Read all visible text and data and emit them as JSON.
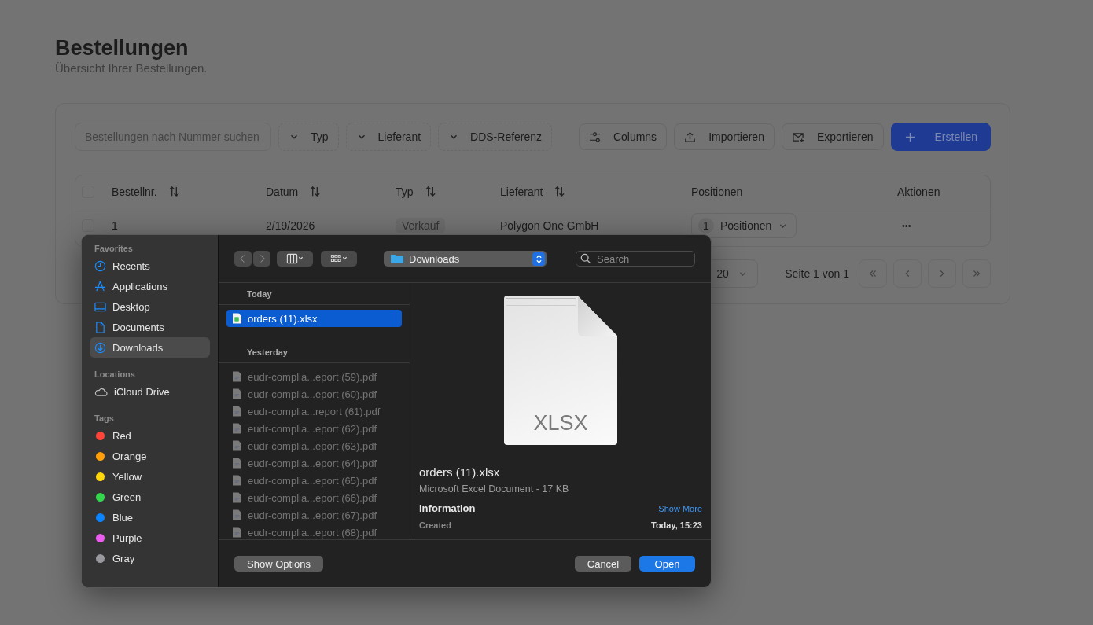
{
  "page": {
    "title": "Bestellungen",
    "subtitle": "Übersicht Ihrer Bestellungen."
  },
  "toolbar": {
    "search": {
      "placeholder": "Bestellungen nach Nummer suchen"
    },
    "filters": [
      {
        "label": "Typ"
      },
      {
        "label": "Lieferant"
      },
      {
        "label": "DDS-Referenz"
      }
    ],
    "buttons": [
      {
        "label": "Columns",
        "kind": "columns"
      },
      {
        "label": "Importieren",
        "kind": "import"
      },
      {
        "label": "Exportieren",
        "kind": "export"
      },
      {
        "label": "Erstellen",
        "kind": "create"
      }
    ]
  },
  "table": {
    "select_all": {
      "checked": false
    },
    "columns": [
      {
        "label": "Bestellnr.",
        "sortable": true
      },
      {
        "label": "Datum",
        "sortable": true
      },
      {
        "label": "Typ",
        "sortable": true
      },
      {
        "label": "Lieferant",
        "sortable": true
      },
      {
        "label": "Positionen",
        "sortable": false
      },
      {
        "label": "Aktionen",
        "sortable": false
      }
    ],
    "rows": [
      {
        "checked": false,
        "number": "1",
        "date": "2/19/2026",
        "type": "Verkauf",
        "supplier": "Polygon One GmbH",
        "positions_count": "1",
        "positions_label": "Positionen",
        "actions": "•••"
      }
    ]
  },
  "pagination": {
    "page_size": "20",
    "page_info": "Seite 1 von 1"
  },
  "dialog": {
    "location": "Downloads",
    "search": {
      "placeholder": "Search"
    },
    "sidebar": [
      {
        "heading": "Favorites",
        "items": [
          {
            "label": "Recents",
            "kind": "recents",
            "selected": false
          },
          {
            "label": "Applications",
            "kind": "applications",
            "selected": false
          },
          {
            "label": "Desktop",
            "kind": "desktop",
            "selected": false
          },
          {
            "label": "Documents",
            "kind": "documents",
            "selected": false
          },
          {
            "label": "Downloads",
            "kind": "downloads",
            "selected": true
          }
        ]
      },
      {
        "heading": "Locations",
        "items": [
          {
            "label": "iCloud Drive",
            "kind": "icloud",
            "selected": false
          }
        ]
      },
      {
        "heading": "Tags",
        "items": [
          {
            "label": "Red",
            "kind": "tag",
            "color": "#ff453a",
            "selected": false
          },
          {
            "label": "Orange",
            "kind": "tag",
            "color": "#ff9f0a",
            "selected": false
          },
          {
            "label": "Yellow",
            "kind": "tag",
            "color": "#ffd60a",
            "selected": false
          },
          {
            "label": "Green",
            "kind": "tag",
            "color": "#32d74b",
            "selected": false
          },
          {
            "label": "Blue",
            "kind": "tag",
            "color": "#0a84ff",
            "selected": false
          },
          {
            "label": "Purple",
            "kind": "tag",
            "color": "#ec5cf0",
            "selected": false
          },
          {
            "label": "Gray",
            "kind": "tag",
            "color": "#98989d",
            "selected": false
          }
        ]
      }
    ],
    "groups": [
      {
        "heading": "Today",
        "files": [
          {
            "name": "orders (11).xlsx",
            "kind": "xlsx",
            "selected": true,
            "disabled": false
          }
        ]
      },
      {
        "heading": "Yesterday",
        "files": [
          {
            "name": "eudr-complia...eport (59).pdf",
            "kind": "pdf",
            "selected": false,
            "disabled": true
          },
          {
            "name": "eudr-complia...eport (60).pdf",
            "kind": "pdf",
            "selected": false,
            "disabled": true
          },
          {
            "name": "eudr-complia...report (61).pdf",
            "kind": "pdf",
            "selected": false,
            "disabled": true
          },
          {
            "name": "eudr-complia...eport (62).pdf",
            "kind": "pdf",
            "selected": false,
            "disabled": true
          },
          {
            "name": "eudr-complia...eport (63).pdf",
            "kind": "pdf",
            "selected": false,
            "disabled": true
          },
          {
            "name": "eudr-complia...eport (64).pdf",
            "kind": "pdf",
            "selected": false,
            "disabled": true
          },
          {
            "name": "eudr-complia...eport (65).pdf",
            "kind": "pdf",
            "selected": false,
            "disabled": true
          },
          {
            "name": "eudr-complia...eport (66).pdf",
            "kind": "pdf",
            "selected": false,
            "disabled": true
          },
          {
            "name": "eudr-complia...eport (67).pdf",
            "kind": "pdf",
            "selected": false,
            "disabled": true
          },
          {
            "name": "eudr-complia...eport (68).pdf",
            "kind": "pdf",
            "selected": false,
            "disabled": true
          }
        ]
      }
    ],
    "preview": {
      "icon_label": "XLSX",
      "file_name": "orders (11).xlsx",
      "file_info": "Microsoft Excel Document - 17 KB",
      "info_heading": "Information",
      "show_more": "Show More",
      "fields": [
        {
          "label": "Created",
          "value": "Today, 15:23"
        }
      ]
    },
    "buttons": [
      {
        "label": "Show Options",
        "kind": "options"
      },
      {
        "label": "Cancel",
        "kind": "cancel"
      },
      {
        "label": "Open",
        "kind": "default"
      }
    ]
  }
}
